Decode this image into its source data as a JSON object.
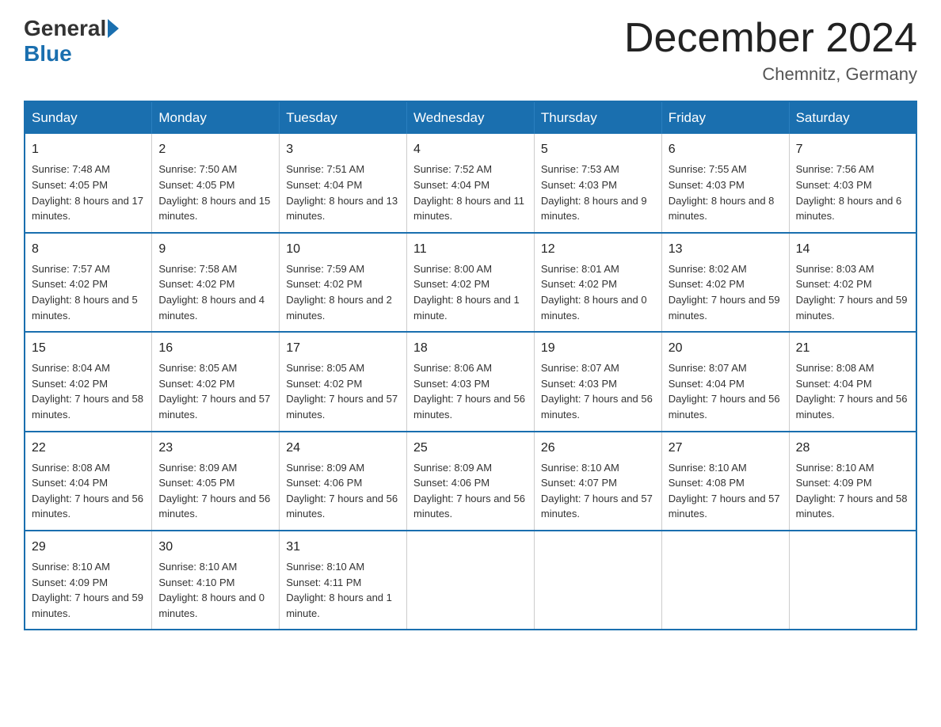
{
  "header": {
    "logo_general": "General",
    "logo_blue": "Blue",
    "month_title": "December 2024",
    "location": "Chemnitz, Germany"
  },
  "weekdays": [
    "Sunday",
    "Monday",
    "Tuesday",
    "Wednesday",
    "Thursday",
    "Friday",
    "Saturday"
  ],
  "weeks": [
    [
      {
        "day": "1",
        "sunrise": "7:48 AM",
        "sunset": "4:05 PM",
        "daylight": "8 hours and 17 minutes."
      },
      {
        "day": "2",
        "sunrise": "7:50 AM",
        "sunset": "4:05 PM",
        "daylight": "8 hours and 15 minutes."
      },
      {
        "day": "3",
        "sunrise": "7:51 AM",
        "sunset": "4:04 PM",
        "daylight": "8 hours and 13 minutes."
      },
      {
        "day": "4",
        "sunrise": "7:52 AM",
        "sunset": "4:04 PM",
        "daylight": "8 hours and 11 minutes."
      },
      {
        "day": "5",
        "sunrise": "7:53 AM",
        "sunset": "4:03 PM",
        "daylight": "8 hours and 9 minutes."
      },
      {
        "day": "6",
        "sunrise": "7:55 AM",
        "sunset": "4:03 PM",
        "daylight": "8 hours and 8 minutes."
      },
      {
        "day": "7",
        "sunrise": "7:56 AM",
        "sunset": "4:03 PM",
        "daylight": "8 hours and 6 minutes."
      }
    ],
    [
      {
        "day": "8",
        "sunrise": "7:57 AM",
        "sunset": "4:02 PM",
        "daylight": "8 hours and 5 minutes."
      },
      {
        "day": "9",
        "sunrise": "7:58 AM",
        "sunset": "4:02 PM",
        "daylight": "8 hours and 4 minutes."
      },
      {
        "day": "10",
        "sunrise": "7:59 AM",
        "sunset": "4:02 PM",
        "daylight": "8 hours and 2 minutes."
      },
      {
        "day": "11",
        "sunrise": "8:00 AM",
        "sunset": "4:02 PM",
        "daylight": "8 hours and 1 minute."
      },
      {
        "day": "12",
        "sunrise": "8:01 AM",
        "sunset": "4:02 PM",
        "daylight": "8 hours and 0 minutes."
      },
      {
        "day": "13",
        "sunrise": "8:02 AM",
        "sunset": "4:02 PM",
        "daylight": "7 hours and 59 minutes."
      },
      {
        "day": "14",
        "sunrise": "8:03 AM",
        "sunset": "4:02 PM",
        "daylight": "7 hours and 59 minutes."
      }
    ],
    [
      {
        "day": "15",
        "sunrise": "8:04 AM",
        "sunset": "4:02 PM",
        "daylight": "7 hours and 58 minutes."
      },
      {
        "day": "16",
        "sunrise": "8:05 AM",
        "sunset": "4:02 PM",
        "daylight": "7 hours and 57 minutes."
      },
      {
        "day": "17",
        "sunrise": "8:05 AM",
        "sunset": "4:02 PM",
        "daylight": "7 hours and 57 minutes."
      },
      {
        "day": "18",
        "sunrise": "8:06 AM",
        "sunset": "4:03 PM",
        "daylight": "7 hours and 56 minutes."
      },
      {
        "day": "19",
        "sunrise": "8:07 AM",
        "sunset": "4:03 PM",
        "daylight": "7 hours and 56 minutes."
      },
      {
        "day": "20",
        "sunrise": "8:07 AM",
        "sunset": "4:04 PM",
        "daylight": "7 hours and 56 minutes."
      },
      {
        "day": "21",
        "sunrise": "8:08 AM",
        "sunset": "4:04 PM",
        "daylight": "7 hours and 56 minutes."
      }
    ],
    [
      {
        "day": "22",
        "sunrise": "8:08 AM",
        "sunset": "4:04 PM",
        "daylight": "7 hours and 56 minutes."
      },
      {
        "day": "23",
        "sunrise": "8:09 AM",
        "sunset": "4:05 PM",
        "daylight": "7 hours and 56 minutes."
      },
      {
        "day": "24",
        "sunrise": "8:09 AM",
        "sunset": "4:06 PM",
        "daylight": "7 hours and 56 minutes."
      },
      {
        "day": "25",
        "sunrise": "8:09 AM",
        "sunset": "4:06 PM",
        "daylight": "7 hours and 56 minutes."
      },
      {
        "day": "26",
        "sunrise": "8:10 AM",
        "sunset": "4:07 PM",
        "daylight": "7 hours and 57 minutes."
      },
      {
        "day": "27",
        "sunrise": "8:10 AM",
        "sunset": "4:08 PM",
        "daylight": "7 hours and 57 minutes."
      },
      {
        "day": "28",
        "sunrise": "8:10 AM",
        "sunset": "4:09 PM",
        "daylight": "7 hours and 58 minutes."
      }
    ],
    [
      {
        "day": "29",
        "sunrise": "8:10 AM",
        "sunset": "4:09 PM",
        "daylight": "7 hours and 59 minutes."
      },
      {
        "day": "30",
        "sunrise": "8:10 AM",
        "sunset": "4:10 PM",
        "daylight": "8 hours and 0 minutes."
      },
      {
        "day": "31",
        "sunrise": "8:10 AM",
        "sunset": "4:11 PM",
        "daylight": "8 hours and 1 minute."
      },
      null,
      null,
      null,
      null
    ]
  ]
}
